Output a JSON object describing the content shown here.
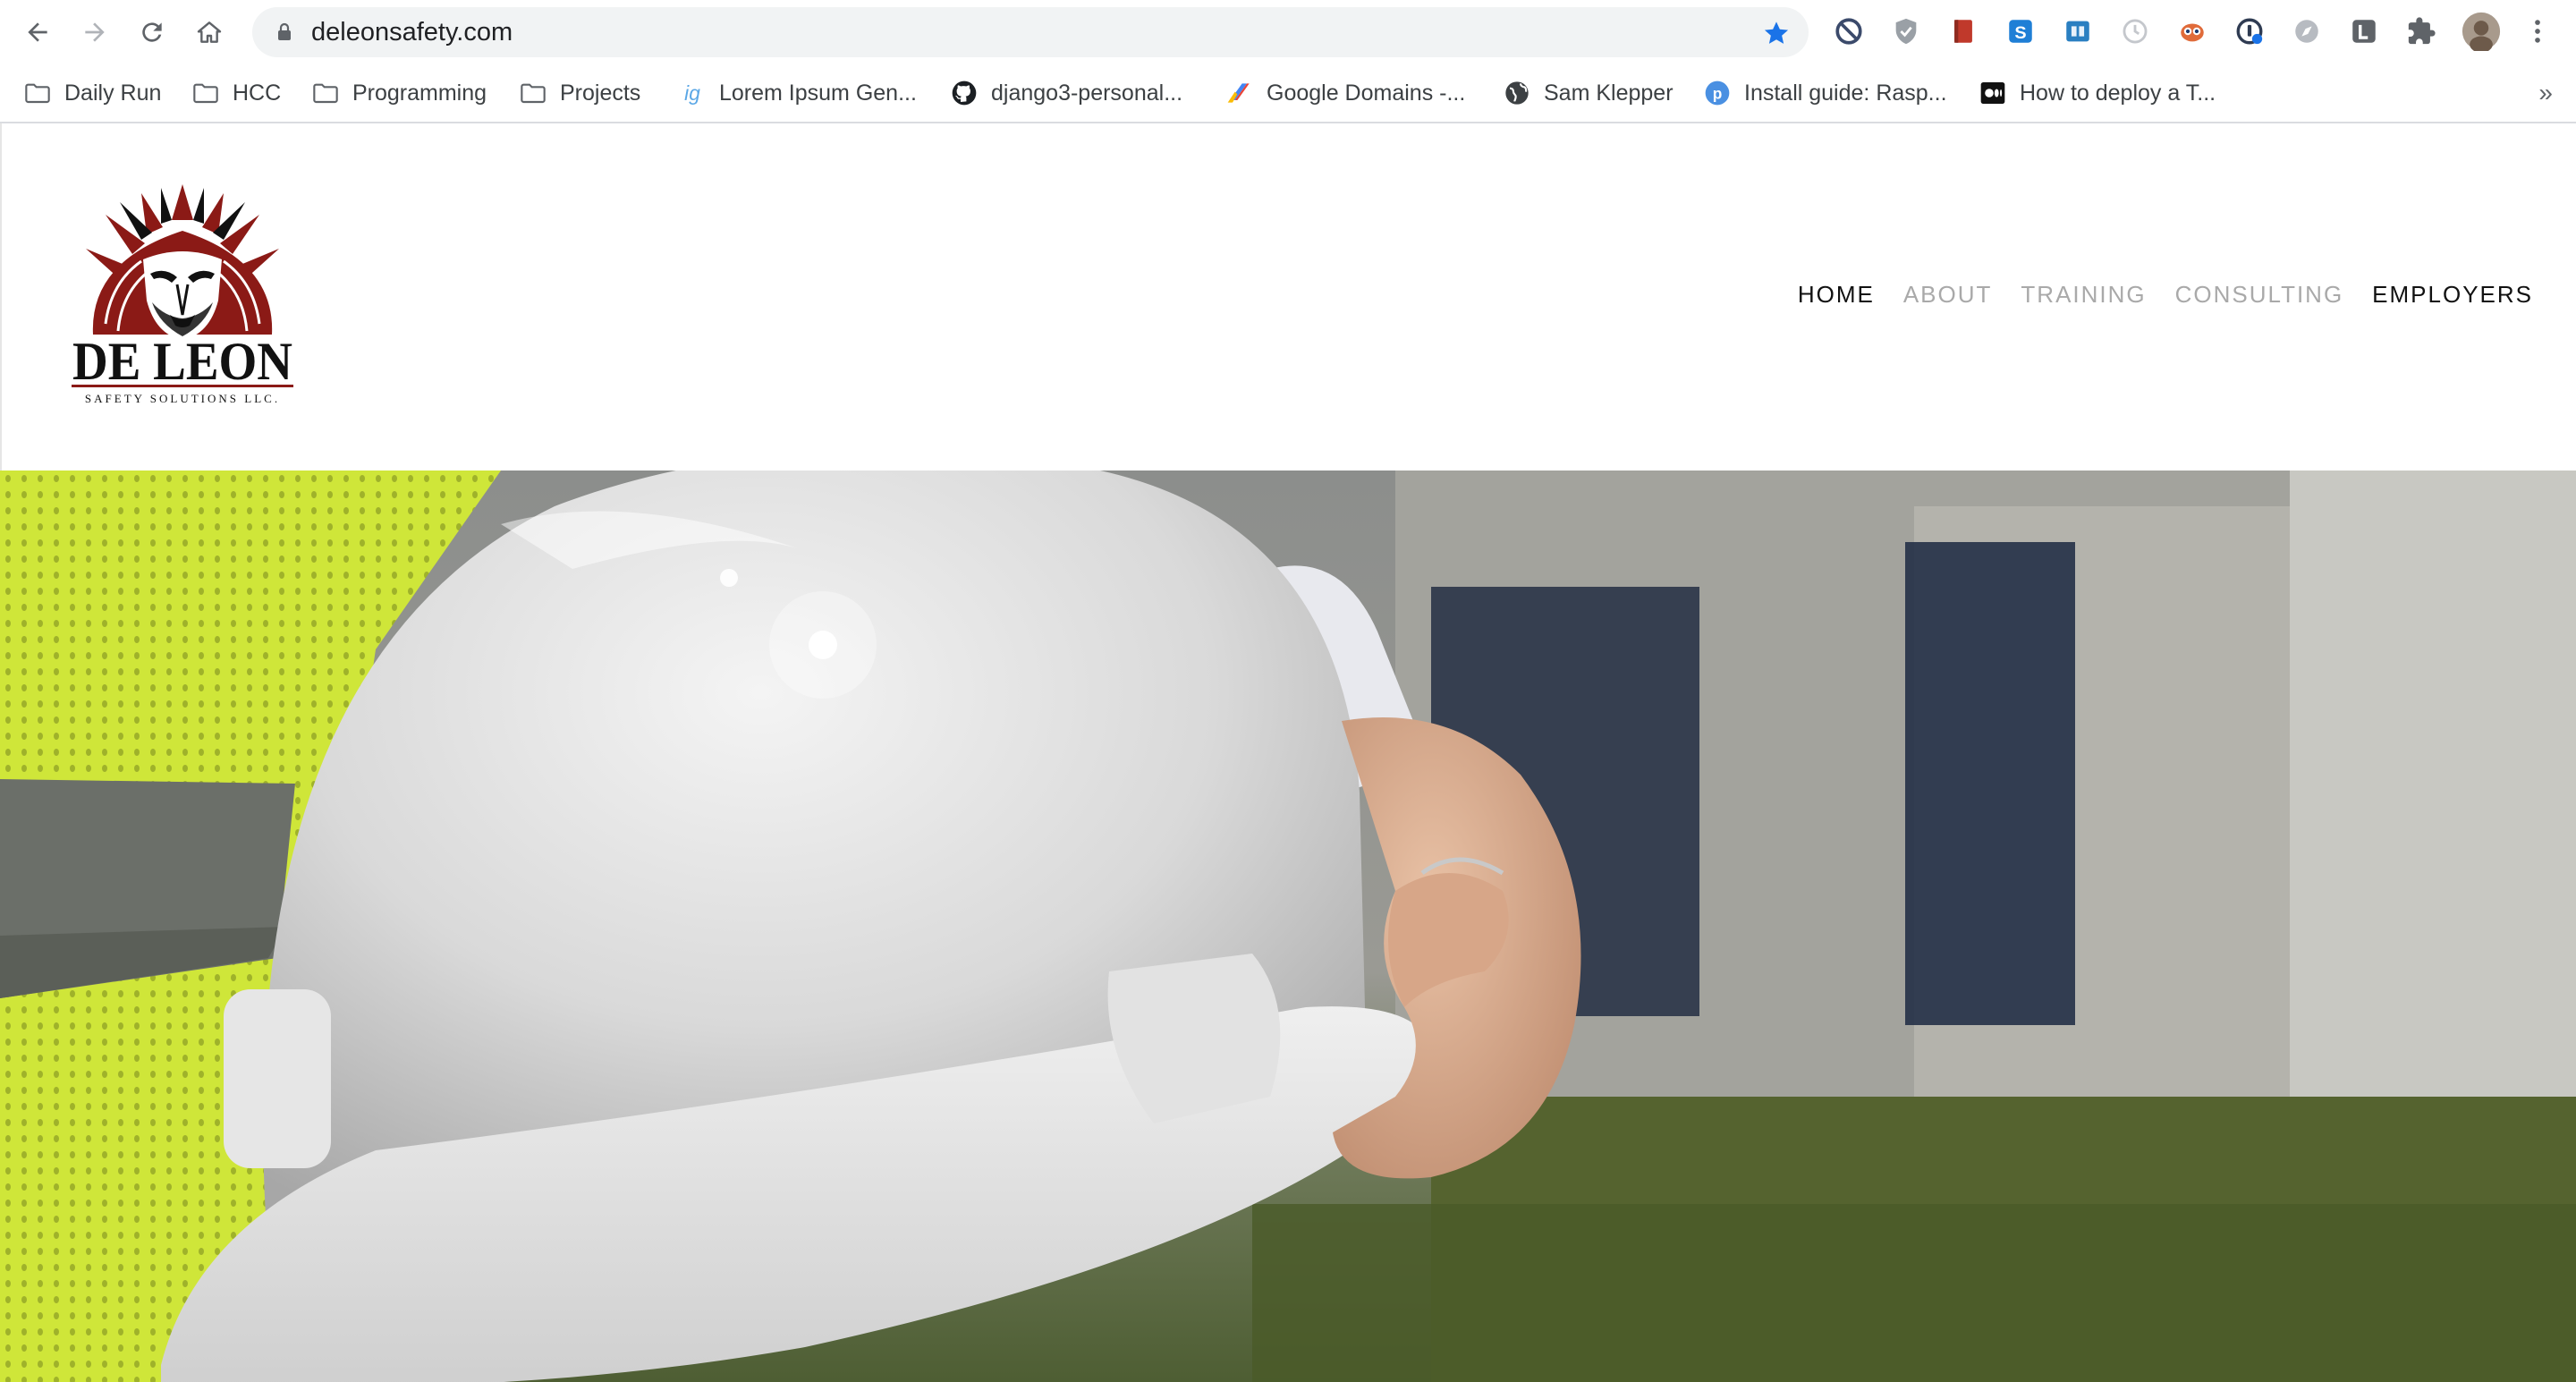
{
  "browser": {
    "url": "deleonsafety.com",
    "bookmarks": [
      {
        "label": "Daily Run",
        "icon": "folder-icon"
      },
      {
        "label": "HCC",
        "icon": "folder-icon"
      },
      {
        "label": "Programming",
        "icon": "folder-icon"
      },
      {
        "label": "Projects",
        "icon": "folder-icon"
      },
      {
        "label": "Lorem Ipsum Gen...",
        "icon": "ig-icon"
      },
      {
        "label": "django3-personal...",
        "icon": "github-icon"
      },
      {
        "label": "Google Domains -...",
        "icon": "google-domains-icon"
      },
      {
        "label": "Sam Klepper",
        "icon": "globe-icon"
      },
      {
        "label": "Install guide: Rasp...",
        "icon": "p-icon"
      },
      {
        "label": "How to deploy a T...",
        "icon": "medium-icon"
      }
    ],
    "more_label": "»"
  },
  "site": {
    "logo": {
      "name": "DE LEON",
      "tagline": "SAFETY SOLUTIONS LLC."
    },
    "nav": [
      {
        "label": "HOME"
      },
      {
        "label": "ABOUT"
      },
      {
        "label": "TRAINING"
      },
      {
        "label": "CONSULTING"
      },
      {
        "label": "EMPLOYERS"
      }
    ],
    "hero": {
      "image": "white-hard-hat-held-by-worker"
    }
  },
  "colors": {
    "accent_blue": "#1a73e8",
    "logo_red": "#8b1a16",
    "nav_active": "#111111",
    "nav_muted": "#a9a9a9",
    "vest_green": "#cfe639"
  }
}
